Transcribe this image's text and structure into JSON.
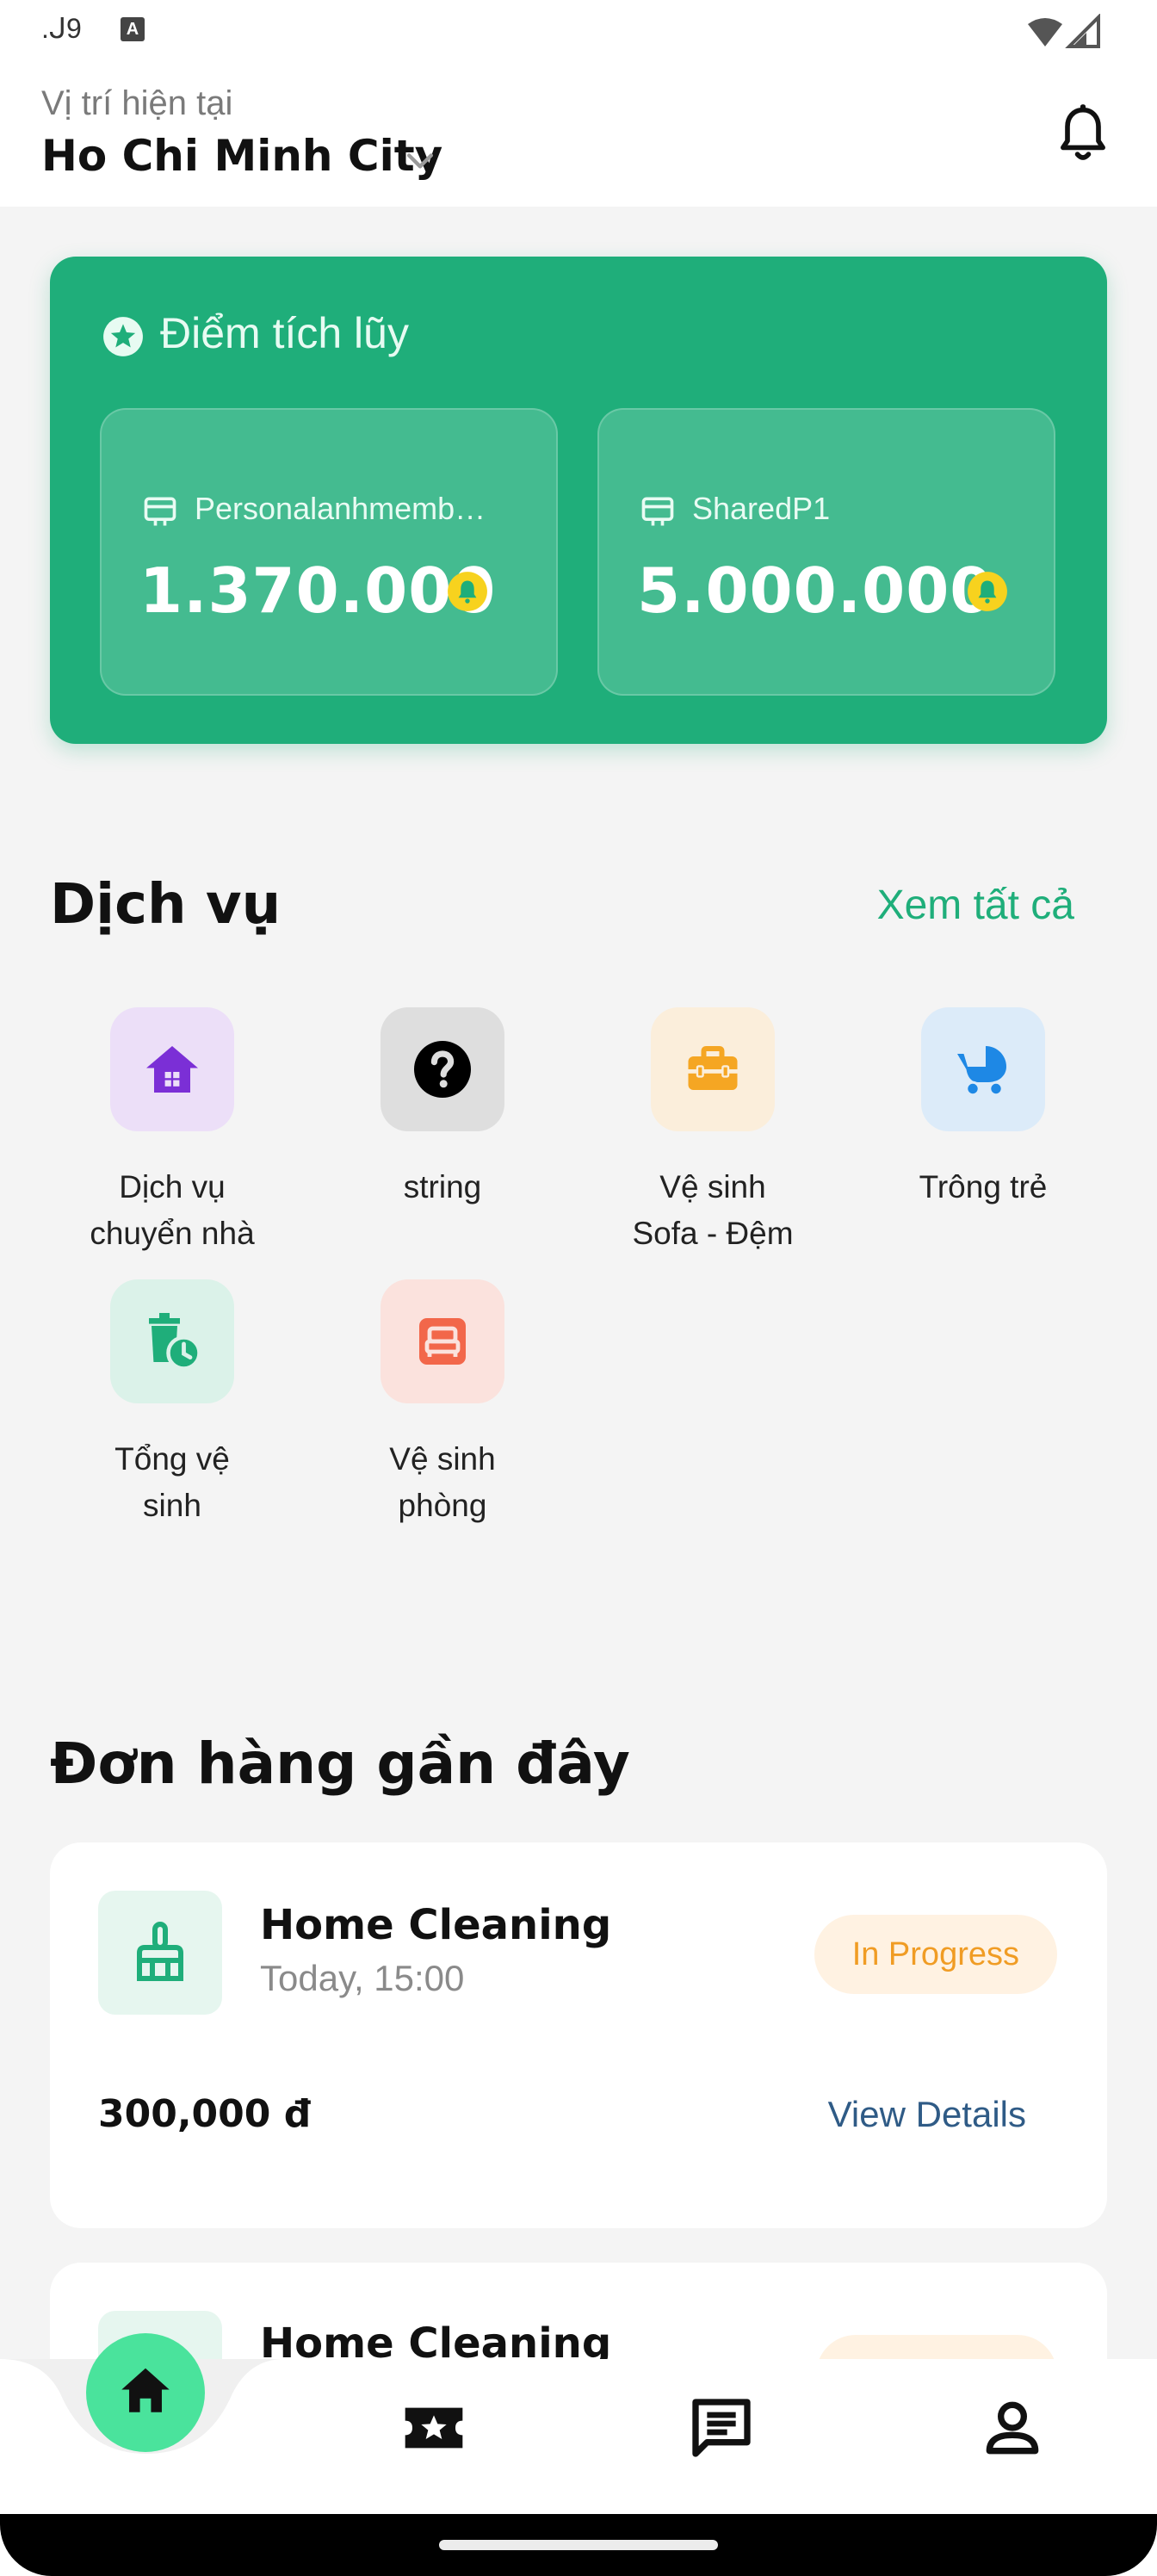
{
  "status_bar": {
    "time": ".ᒍ9",
    "notification_badge": "A"
  },
  "header": {
    "location_label": "Vị trí hiện tại",
    "city": "Ho Chi Minh City"
  },
  "points": {
    "title": "Điểm tích lũy",
    "wallets": [
      {
        "name": "Personalanhmemb…",
        "value": "1.370.000"
      },
      {
        "name": "SharedP1",
        "value": "5.000.000"
      }
    ]
  },
  "services": {
    "title": "Dịch vụ",
    "see_all": "Xem tất cả",
    "items": [
      {
        "label_line1": "Dịch vụ",
        "label_line2": "chuyển nhà",
        "icon": "house-icon",
        "color": "#7b2fd6",
        "bg": "#ecdff8"
      },
      {
        "label_line1": "string",
        "label_line2": "",
        "icon": "question-icon",
        "color": "#000000",
        "bg": "#dedede"
      },
      {
        "label_line1": "Vệ sinh",
        "label_line2": "Sofa - Đệm",
        "icon": "briefcase-icon",
        "color": "#f5a623",
        "bg": "#fbeedb"
      },
      {
        "label_line1": "Trông trẻ",
        "label_line2": "",
        "icon": "stroller-icon",
        "color": "#1e88e5",
        "bg": "#dcebf9"
      },
      {
        "label_line1": "Tổng vệ",
        "label_line2": "sinh",
        "icon": "trash-clock-icon",
        "color": "#1fae7a",
        "bg": "#dbf2e9"
      },
      {
        "label_line1": "Vệ sinh",
        "label_line2": "phòng",
        "icon": "bed-icon",
        "color": "#f2674a",
        "bg": "#fbe2dd"
      }
    ]
  },
  "orders": {
    "title": "Đơn hàng gần đây",
    "items": [
      {
        "name": "Home Cleaning",
        "time": "Today, 15:00",
        "status": "In Progress",
        "price": "300,000 đ",
        "details": "View Details"
      },
      {
        "name": "Home Cleaning",
        "time": "",
        "status": "",
        "price": "",
        "details": ""
      }
    ]
  },
  "nav": {
    "items": [
      "home-icon",
      "ticket-star-icon",
      "chat-icon",
      "profile-icon"
    ],
    "accent": "#4ae39c"
  }
}
